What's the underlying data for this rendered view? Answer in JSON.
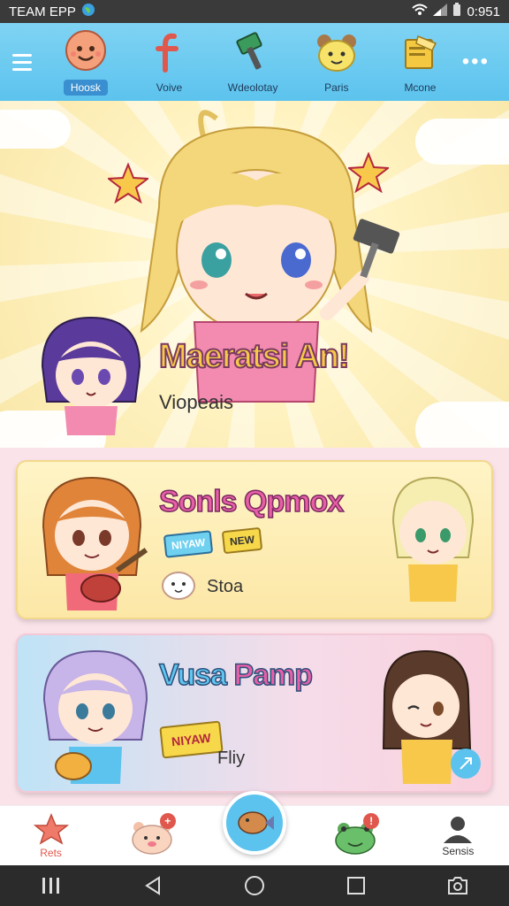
{
  "status_bar": {
    "carrier": "TEAM EPP",
    "time": "0:951"
  },
  "top_nav": {
    "items": [
      {
        "label": "Hoosk",
        "icon": "smiley-face-icon",
        "active": true
      },
      {
        "label": "Voive",
        "icon": "letter-f-icon"
      },
      {
        "label": "Wdeolotay",
        "icon": "hammer-icon"
      },
      {
        "label": "Paris",
        "icon": "bear-face-icon"
      },
      {
        "label": "Mcone",
        "icon": "folder-icon"
      }
    ],
    "more_icon": "more-dots-icon"
  },
  "hero": {
    "title": "Maeratsi An!",
    "subtitle": "Viopeais"
  },
  "cards": [
    {
      "title": "Sonls Qpmox",
      "badges": [
        "NIYAW",
        "NEW"
      ],
      "label": "Stoa"
    },
    {
      "title_part1": "Vusa",
      "title_part2": "Pamp",
      "badge": "NIYAW",
      "label": "Fliy"
    }
  ],
  "bottom_nav": {
    "items": [
      {
        "label": "Rets",
        "icon": "star-icon"
      },
      {
        "label": "",
        "icon": "pig-face-icon",
        "badge": "+"
      },
      {
        "label": "",
        "icon": "fish-icon"
      },
      {
        "label": "",
        "icon": "frog-face-icon",
        "badge": "!"
      },
      {
        "label": "Sensis",
        "icon": "user-icon"
      }
    ]
  },
  "colors": {
    "accent": "#5cc3ee",
    "pink": "#e85fa8",
    "yellow": "#f7c84a"
  }
}
